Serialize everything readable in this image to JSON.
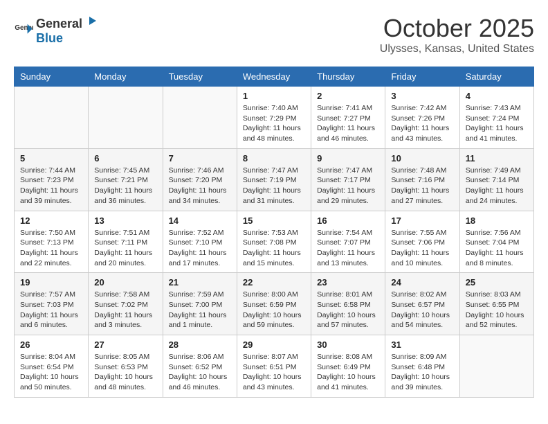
{
  "logo": {
    "general": "General",
    "blue": "Blue"
  },
  "header": {
    "month": "October 2025",
    "location": "Ulysses, Kansas, United States"
  },
  "days_of_week": [
    "Sunday",
    "Monday",
    "Tuesday",
    "Wednesday",
    "Thursday",
    "Friday",
    "Saturday"
  ],
  "weeks": [
    {
      "days": [
        {
          "number": "",
          "sunrise": "",
          "sunset": "",
          "daylight": ""
        },
        {
          "number": "",
          "sunrise": "",
          "sunset": "",
          "daylight": ""
        },
        {
          "number": "",
          "sunrise": "",
          "sunset": "",
          "daylight": ""
        },
        {
          "number": "1",
          "sunrise": "Sunrise: 7:40 AM",
          "sunset": "Sunset: 7:29 PM",
          "daylight": "Daylight: 11 hours and 48 minutes."
        },
        {
          "number": "2",
          "sunrise": "Sunrise: 7:41 AM",
          "sunset": "Sunset: 7:27 PM",
          "daylight": "Daylight: 11 hours and 46 minutes."
        },
        {
          "number": "3",
          "sunrise": "Sunrise: 7:42 AM",
          "sunset": "Sunset: 7:26 PM",
          "daylight": "Daylight: 11 hours and 43 minutes."
        },
        {
          "number": "4",
          "sunrise": "Sunrise: 7:43 AM",
          "sunset": "Sunset: 7:24 PM",
          "daylight": "Daylight: 11 hours and 41 minutes."
        }
      ]
    },
    {
      "days": [
        {
          "number": "5",
          "sunrise": "Sunrise: 7:44 AM",
          "sunset": "Sunset: 7:23 PM",
          "daylight": "Daylight: 11 hours and 39 minutes."
        },
        {
          "number": "6",
          "sunrise": "Sunrise: 7:45 AM",
          "sunset": "Sunset: 7:21 PM",
          "daylight": "Daylight: 11 hours and 36 minutes."
        },
        {
          "number": "7",
          "sunrise": "Sunrise: 7:46 AM",
          "sunset": "Sunset: 7:20 PM",
          "daylight": "Daylight: 11 hours and 34 minutes."
        },
        {
          "number": "8",
          "sunrise": "Sunrise: 7:47 AM",
          "sunset": "Sunset: 7:19 PM",
          "daylight": "Daylight: 11 hours and 31 minutes."
        },
        {
          "number": "9",
          "sunrise": "Sunrise: 7:47 AM",
          "sunset": "Sunset: 7:17 PM",
          "daylight": "Daylight: 11 hours and 29 minutes."
        },
        {
          "number": "10",
          "sunrise": "Sunrise: 7:48 AM",
          "sunset": "Sunset: 7:16 PM",
          "daylight": "Daylight: 11 hours and 27 minutes."
        },
        {
          "number": "11",
          "sunrise": "Sunrise: 7:49 AM",
          "sunset": "Sunset: 7:14 PM",
          "daylight": "Daylight: 11 hours and 24 minutes."
        }
      ]
    },
    {
      "days": [
        {
          "number": "12",
          "sunrise": "Sunrise: 7:50 AM",
          "sunset": "Sunset: 7:13 PM",
          "daylight": "Daylight: 11 hours and 22 minutes."
        },
        {
          "number": "13",
          "sunrise": "Sunrise: 7:51 AM",
          "sunset": "Sunset: 7:11 PM",
          "daylight": "Daylight: 11 hours and 20 minutes."
        },
        {
          "number": "14",
          "sunrise": "Sunrise: 7:52 AM",
          "sunset": "Sunset: 7:10 PM",
          "daylight": "Daylight: 11 hours and 17 minutes."
        },
        {
          "number": "15",
          "sunrise": "Sunrise: 7:53 AM",
          "sunset": "Sunset: 7:08 PM",
          "daylight": "Daylight: 11 hours and 15 minutes."
        },
        {
          "number": "16",
          "sunrise": "Sunrise: 7:54 AM",
          "sunset": "Sunset: 7:07 PM",
          "daylight": "Daylight: 11 hours and 13 minutes."
        },
        {
          "number": "17",
          "sunrise": "Sunrise: 7:55 AM",
          "sunset": "Sunset: 7:06 PM",
          "daylight": "Daylight: 11 hours and 10 minutes."
        },
        {
          "number": "18",
          "sunrise": "Sunrise: 7:56 AM",
          "sunset": "Sunset: 7:04 PM",
          "daylight": "Daylight: 11 hours and 8 minutes."
        }
      ]
    },
    {
      "days": [
        {
          "number": "19",
          "sunrise": "Sunrise: 7:57 AM",
          "sunset": "Sunset: 7:03 PM",
          "daylight": "Daylight: 11 hours and 6 minutes."
        },
        {
          "number": "20",
          "sunrise": "Sunrise: 7:58 AM",
          "sunset": "Sunset: 7:02 PM",
          "daylight": "Daylight: 11 hours and 3 minutes."
        },
        {
          "number": "21",
          "sunrise": "Sunrise: 7:59 AM",
          "sunset": "Sunset: 7:00 PM",
          "daylight": "Daylight: 11 hours and 1 minute."
        },
        {
          "number": "22",
          "sunrise": "Sunrise: 8:00 AM",
          "sunset": "Sunset: 6:59 PM",
          "daylight": "Daylight: 10 hours and 59 minutes."
        },
        {
          "number": "23",
          "sunrise": "Sunrise: 8:01 AM",
          "sunset": "Sunset: 6:58 PM",
          "daylight": "Daylight: 10 hours and 57 minutes."
        },
        {
          "number": "24",
          "sunrise": "Sunrise: 8:02 AM",
          "sunset": "Sunset: 6:57 PM",
          "daylight": "Daylight: 10 hours and 54 minutes."
        },
        {
          "number": "25",
          "sunrise": "Sunrise: 8:03 AM",
          "sunset": "Sunset: 6:55 PM",
          "daylight": "Daylight: 10 hours and 52 minutes."
        }
      ]
    },
    {
      "days": [
        {
          "number": "26",
          "sunrise": "Sunrise: 8:04 AM",
          "sunset": "Sunset: 6:54 PM",
          "daylight": "Daylight: 10 hours and 50 minutes."
        },
        {
          "number": "27",
          "sunrise": "Sunrise: 8:05 AM",
          "sunset": "Sunset: 6:53 PM",
          "daylight": "Daylight: 10 hours and 48 minutes."
        },
        {
          "number": "28",
          "sunrise": "Sunrise: 8:06 AM",
          "sunset": "Sunset: 6:52 PM",
          "daylight": "Daylight: 10 hours and 46 minutes."
        },
        {
          "number": "29",
          "sunrise": "Sunrise: 8:07 AM",
          "sunset": "Sunset: 6:51 PM",
          "daylight": "Daylight: 10 hours and 43 minutes."
        },
        {
          "number": "30",
          "sunrise": "Sunrise: 8:08 AM",
          "sunset": "Sunset: 6:49 PM",
          "daylight": "Daylight: 10 hours and 41 minutes."
        },
        {
          "number": "31",
          "sunrise": "Sunrise: 8:09 AM",
          "sunset": "Sunset: 6:48 PM",
          "daylight": "Daylight: 10 hours and 39 minutes."
        },
        {
          "number": "",
          "sunrise": "",
          "sunset": "",
          "daylight": ""
        }
      ]
    }
  ]
}
